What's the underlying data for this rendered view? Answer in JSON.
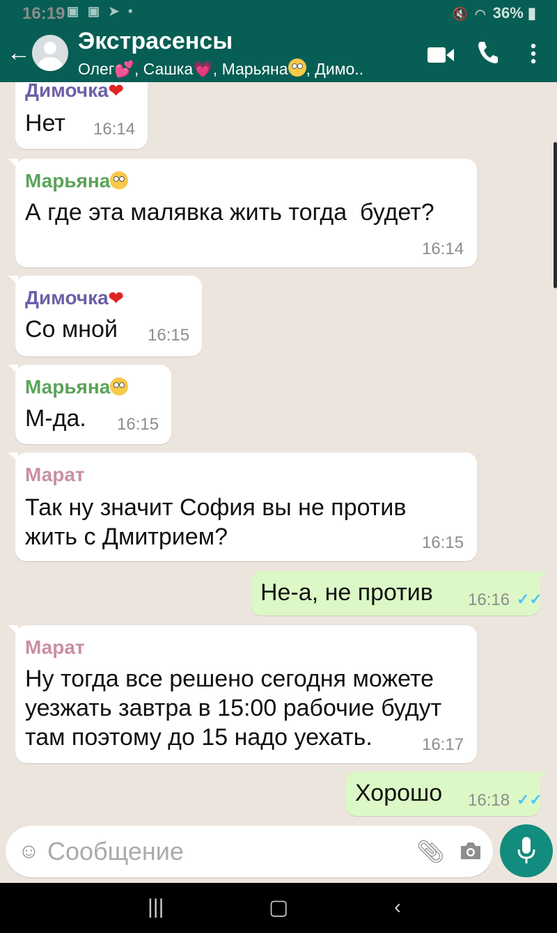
{
  "status_bar": {
    "time": "16:19",
    "battery": "36%"
  },
  "header": {
    "title": "Экстрасенсы",
    "members": [
      {
        "name": "Олег",
        "emoji": "💕"
      },
      {
        "name": "Сашка",
        "emoji": "💗"
      },
      {
        "name": "Марьяна",
        "emoji": "🙄"
      },
      {
        "name": "Димо..",
        "emoji": ""
      }
    ]
  },
  "messages": [
    {
      "dir": "in",
      "sender": "Димочка",
      "sender_emoji": "❤",
      "text": "Нет",
      "time": "16:14"
    },
    {
      "dir": "in",
      "sender": "Марьяна",
      "sender_emoji": "🙄",
      "text": "А где эта малявка жить тогда  будет?",
      "time": "16:14"
    },
    {
      "dir": "in",
      "sender": "Димочка",
      "sender_emoji": "❤",
      "text": "Со мной",
      "time": "16:15"
    },
    {
      "dir": "in",
      "sender": "Марьяна",
      "sender_emoji": "🙄",
      "text": "М-да.",
      "time": "16:15"
    },
    {
      "dir": "in",
      "sender": "Марат",
      "text": "Так ну значит София вы не против жить с Дмитрием?",
      "time": "16:15"
    },
    {
      "dir": "out",
      "text": "Не-а, не против",
      "time": "16:16",
      "status": "read"
    },
    {
      "dir": "in",
      "sender": "Марат",
      "text": "Ну тогда все решено сегодня можете уезжать завтра в 15:00 рабочие будут там поэтому до 15 надо уехать.",
      "time": "16:17"
    },
    {
      "dir": "out",
      "text": "Хорошо",
      "time": "16:18",
      "status": "read"
    }
  ],
  "compose": {
    "placeholder": "Сообщение"
  },
  "colors": {
    "header": "#075e54",
    "incoming_bubble": "#ffffff",
    "outgoing_bubble": "#dcf8c6",
    "read_tick": "#4fc3f7",
    "sender_dimochka": "#6e5fa8",
    "sender_maryana": "#5ba35b",
    "sender_marat": "#c98fa4",
    "mic_button": "#128c7e"
  }
}
